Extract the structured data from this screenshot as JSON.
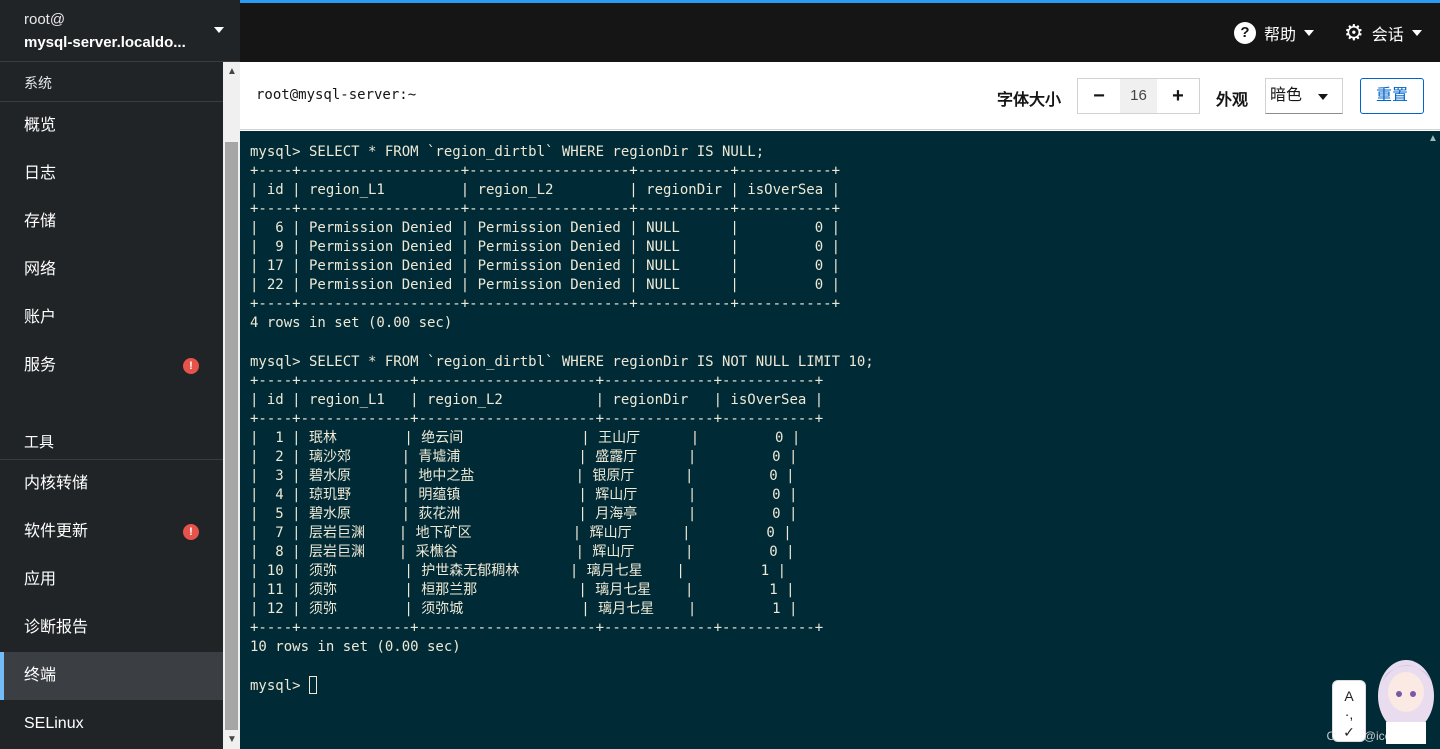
{
  "host": {
    "user": "root@",
    "name": "mysql-server.localdo..."
  },
  "nav": {
    "section_system": "系统",
    "items_top": [
      {
        "label": "概览",
        "alert": false
      },
      {
        "label": "日志",
        "alert": false
      },
      {
        "label": "存储",
        "alert": false
      },
      {
        "label": "网络",
        "alert": false
      },
      {
        "label": "账户",
        "alert": false
      },
      {
        "label": "服务",
        "alert": true
      }
    ],
    "section_tools": "工具",
    "items_tools": [
      {
        "label": "内核转储",
        "alert": false
      },
      {
        "label": "软件更新",
        "alert": true
      },
      {
        "label": "应用",
        "alert": false
      },
      {
        "label": "诊断报告",
        "alert": false
      },
      {
        "label": "终端",
        "alert": false,
        "active": true
      },
      {
        "label": "SELinux",
        "alert": false
      }
    ],
    "alert_glyph": "!"
  },
  "topbar": {
    "help_label": "帮助",
    "session_label": "会话",
    "help_icon": "?",
    "accent_color": "#2b9af3"
  },
  "terminal_header": {
    "title": "root@mysql-server:~",
    "font_size_label": "字体大小",
    "font_size_value": "16",
    "minus": "−",
    "plus": "+",
    "appearance_label": "外观",
    "appearance_value": "暗色",
    "reset_label": "重置"
  },
  "terminal": {
    "background": "#002b36",
    "lines": [
      "mysql> SELECT * FROM `region_dirtbl` WHERE regionDir IS NULL;",
      "+----+-------------------+-------------------+-----------+-----------+",
      "| id | region_L1         | region_L2         | regionDir | isOverSea |",
      "+----+-------------------+-------------------+-----------+-----------+",
      "|  6 | Permission Denied | Permission Denied | NULL      |         0 |",
      "|  9 | Permission Denied | Permission Denied | NULL      |         0 |",
      "| 17 | Permission Denied | Permission Denied | NULL      |         0 |",
      "| 22 | Permission Denied | Permission Denied | NULL      |         0 |",
      "+----+-------------------+-------------------+-----------+-----------+",
      "4 rows in set (0.00 sec)",
      "",
      "mysql> SELECT * FROM `region_dirtbl` WHERE regionDir IS NOT NULL LIMIT 10;",
      "+----+-------------+---------------------+-------------+-----------+",
      "| id | region_L1   | region_L2           | regionDir   | isOverSea |",
      "+----+-------------+---------------------+-------------+-----------+",
      "|  1 | 珉林        | 绝云间              | 王山厅      |         0 |",
      "|  2 | 璃沙郊      | 青墟浦              | 盛露厅      |         0 |",
      "|  3 | 碧水原      | 地中之盐            | 银原厅      |         0 |",
      "|  4 | 琼玑野      | 明蕴镇              | 辉山厅      |         0 |",
      "|  5 | 碧水原      | 荻花洲              | 月海亭      |         0 |",
      "|  7 | 层岩巨渊    | 地下矿区            | 辉山厅      |         0 |",
      "|  8 | 层岩巨渊    | 采樵谷              | 辉山厅      |         0 |",
      "| 10 | 须弥        | 护世森无郁稠林      | 璃月七星    |         1 |",
      "| 11 | 须弥        | 桓那兰那            | 璃月七星    |         1 |",
      "| 12 | 须弥        | 须弥城              | 璃月七星    |         1 |",
      "+----+-------------+---------------------+-------------+-----------+",
      "10 rows in set (0.00 sec)",
      "",
      "mysql> "
    ]
  },
  "watermark": "CSDN @icewolf00",
  "assistant_label": "A\n·,\n✓"
}
